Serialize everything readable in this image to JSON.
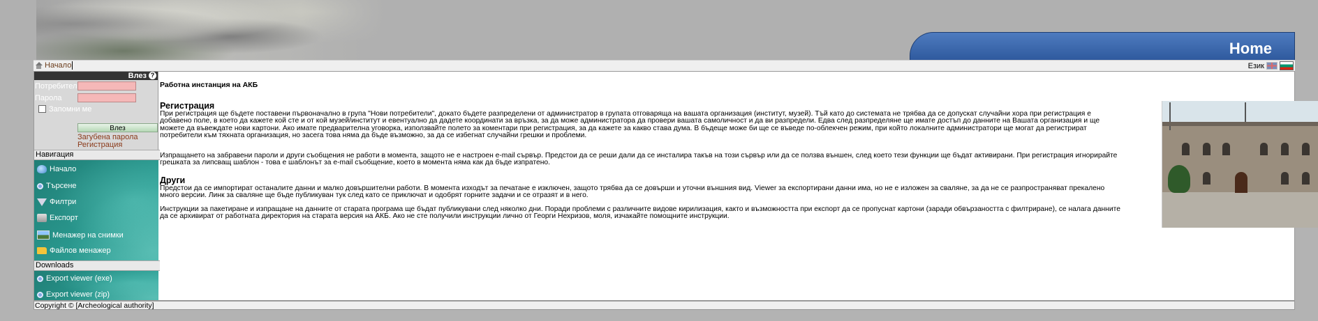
{
  "banner": {
    "home_title": "Home"
  },
  "breadcrumb": {
    "home_label": "Начало"
  },
  "language": {
    "label": "Език",
    "options": [
      "English",
      "Български"
    ],
    "icons": [
      "uk-flag-icon",
      "bulgarian-flag-icon"
    ]
  },
  "login": {
    "header": "Влез",
    "help_icon": "?",
    "username_label": "Потребител",
    "username_value": "",
    "password_label": "Парола",
    "password_value": "",
    "remember_label": "Запомни ме",
    "remember_checked": false,
    "submit_label": "Влез",
    "forgot_link": "Загубена парола",
    "register_link": "Регистрация"
  },
  "navigation": {
    "header": "Навигация",
    "items": [
      {
        "label": "Начало",
        "icon": "home-icon"
      },
      {
        "label": "Търсене",
        "icon": "search-icon"
      },
      {
        "label": "Филтри",
        "icon": "filter-icon"
      },
      {
        "label": "Експорт",
        "icon": "export-icon"
      },
      {
        "label": "Менажер на снимки",
        "icon": "photo-manager-icon"
      },
      {
        "label": "Файлов менажер",
        "icon": "folder-icon"
      }
    ]
  },
  "downloads": {
    "header": "Downloads",
    "items": [
      {
        "label": "Export viewer (exe)",
        "icon": "search-icon"
      },
      {
        "label": "Export viewer (zip)",
        "icon": "search-icon"
      }
    ]
  },
  "main": {
    "instance_title": "Работна инстанция на АКБ",
    "registration_heading": "Регистрация",
    "registration_p1": "При регистрация ще бъдете поставени първоначално в група \"Нови потребители\", докато бъдете разпределени от администратор в групата отговаряща на вашата организация (институт, музей). Тъй като до системата не трябва да се допускат случайни хора при регистрация е добавено поле, в което да кажете кой сте и от кой музей/институт и евентуално да дадете координати за връзка, за да може администратора да провери вашата самоличност и да ви разпредели. Едва след разпределяне ще имате достъп до данните на Вашата организация и ще можете да въвеждате нови картони. Ако имате предварителна уговорка, използвайте полето за коментари при регистрация, за да кажете за какво става дума. В бъдеще може би ще се въведе по-облекчен режим, при който локалните администратори ще могат да регистрират потребители към тяхната организация, но засега това няма да бъде възможно, за да се избегнат случайни грешки и проблеми.",
    "registration_p2": "Изпращането на забравени пароли и други съобщения не работи в момента, защото не е настроен e-mail сървър. Предстои да се реши дали да се инсталира такъв на този сървър или да се ползва външен, след което тези функции ще бъдат активирани. При регистрация игнорирайте грешката за липсващ шаблон - това е шаблонът за e-mail съобщение, което в момента няма как да бъде изпратено.",
    "other_heading": "Други",
    "other_p1": "Предстои да се импортират останалите данни и малко довършителни работи. В момента изходът за печатане е изключен, защото трябва да се довърши и уточни външния вид. Viewer за експортирани данни има, но не е изложен за сваляне, за да не се разпространяват прекалено много версии. Линк за сваляне ще бъде публикуван тук след като се приключат и одобрят горните задачи и се отразят и в него.",
    "other_p2": "Инструкции за пакетиране и изпращане на данните от старата програма ще бъдат публикувани след няколко дни. Поради проблеми с различните видове кирилизация, както и възможността при експорт да се пропуснат картони (заради обвързаността с филтриране), се налага данните да се архивират от работната директория на старата версия на АКБ. Ако не сте получили инструкции лично от Георги Нехризов, моля, изчакайте помощните инструкции."
  },
  "footer": {
    "copyright": "Copyright © [Archeological authority]"
  }
}
